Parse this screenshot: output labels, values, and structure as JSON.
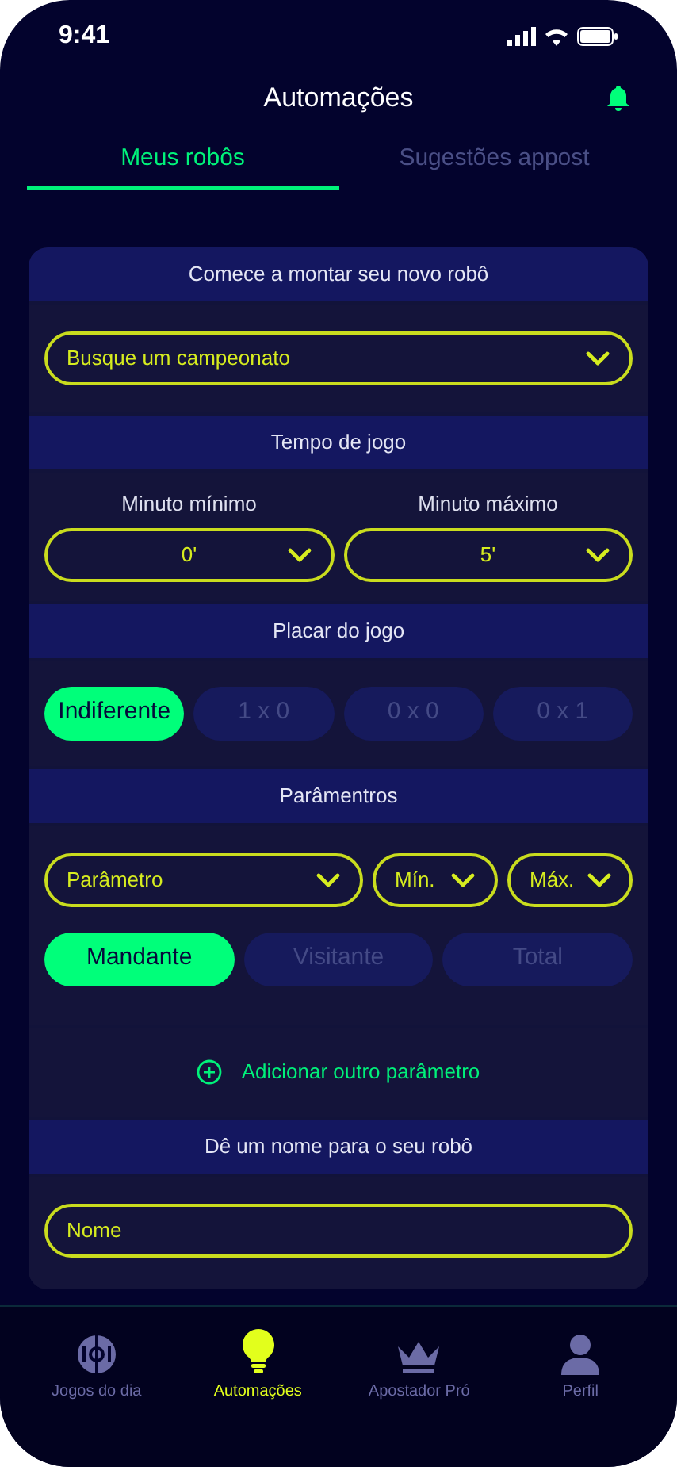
{
  "status_bar": {
    "time": "9:41"
  },
  "header": {
    "title": "Automações"
  },
  "tabs": [
    {
      "label": "Meus robôs",
      "selected": true
    },
    {
      "label": "Sugestões appost",
      "selected": false
    }
  ],
  "start_section": {
    "title": "Comece a montar seu novo robô",
    "championship": {
      "placeholder": "Busque um campeonato"
    }
  },
  "time_section": {
    "title": "Tempo de jogo",
    "min": {
      "label": "Minuto mínimo",
      "value": "0'"
    },
    "max": {
      "label": "Minuto máximo",
      "value": "5'"
    }
  },
  "score_section": {
    "title": "Placar do jogo",
    "options": [
      {
        "label": "Indiferente",
        "selected": true
      },
      {
        "label": "1 x 0",
        "selected": false
      },
      {
        "label": "0 x 0",
        "selected": false
      },
      {
        "label": "0 x 1",
        "selected": false
      }
    ]
  },
  "params_section": {
    "title": "Parâmentros",
    "parameter": "Parâmetro",
    "min": "Mín.",
    "max": "Máx.",
    "sides": [
      {
        "label": "Mandante",
        "selected": true
      },
      {
        "label": "Visitante",
        "selected": false
      },
      {
        "label": "Total",
        "selected": false
      }
    ],
    "add_button": "Adicionar outro parâmetro"
  },
  "name_section": {
    "title": "Dê um nome para o seu robô",
    "name": {
      "placeholder": "Nome"
    }
  },
  "bottom_nav": [
    {
      "kind": "ball",
      "label": "Jogos do dia",
      "selected": false
    },
    {
      "kind": "bulb",
      "label": "Automações",
      "selected": true
    },
    {
      "kind": "crown",
      "label": "Apostador Pró",
      "selected": false
    },
    {
      "kind": "person",
      "label": "Perfil",
      "selected": false
    }
  ]
}
